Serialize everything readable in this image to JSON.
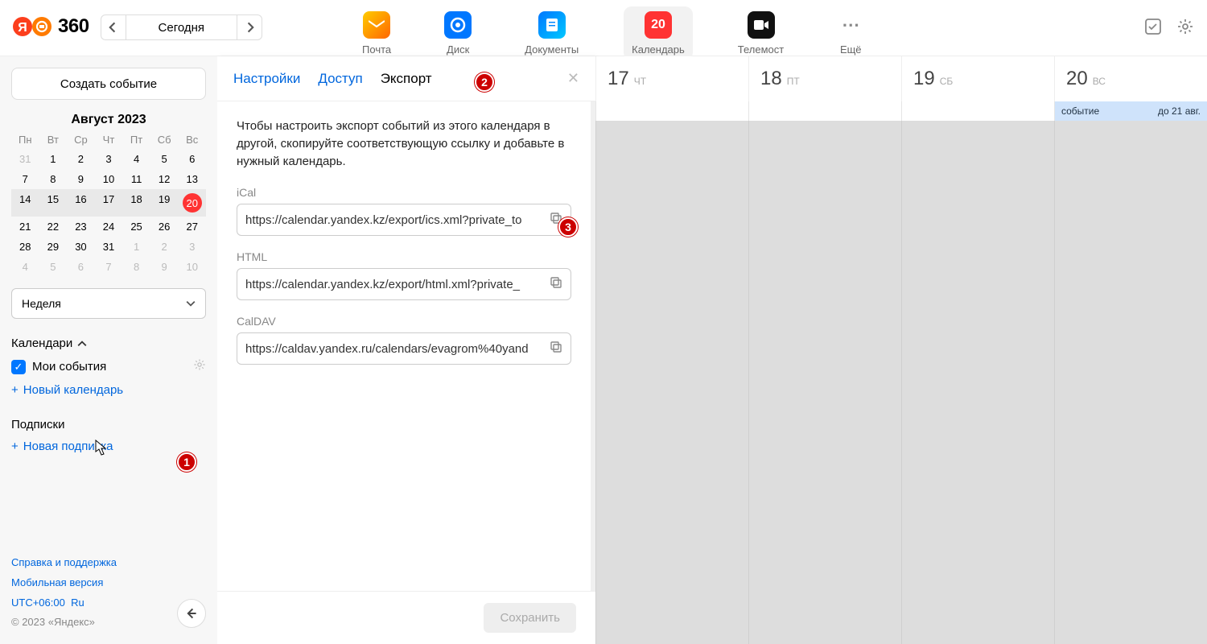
{
  "topbar": {
    "today": "Сегодня",
    "services": {
      "mail": "Почта",
      "disk": "Диск",
      "docs": "Документы",
      "calendar": "Календарь",
      "telemost": "Телемост",
      "more": "Ещё",
      "calendar_badge": "20"
    }
  },
  "sidebar": {
    "create": "Создать событие",
    "month": "Август 2023",
    "dow": [
      "Пн",
      "Вт",
      "Ср",
      "Чт",
      "Пт",
      "Сб",
      "Вс"
    ],
    "weeks": [
      [
        "31",
        "1",
        "2",
        "3",
        "4",
        "5",
        "6"
      ],
      [
        "7",
        "8",
        "9",
        "10",
        "11",
        "12",
        "13"
      ],
      [
        "14",
        "15",
        "16",
        "17",
        "18",
        "19",
        "20"
      ],
      [
        "21",
        "22",
        "23",
        "24",
        "25",
        "26",
        "27"
      ],
      [
        "28",
        "29",
        "30",
        "31",
        "1",
        "2",
        "3"
      ],
      [
        "4",
        "5",
        "6",
        "7",
        "8",
        "9",
        "10"
      ]
    ],
    "view": "Неделя",
    "calendars_label": "Календари",
    "my_events": "Мои события",
    "new_calendar": "Новый календарь",
    "subscriptions_label": "Подписки",
    "new_subscription": "Новая подписка",
    "footer": {
      "help": "Справка и поддержка",
      "mobile": "Мобильная версия",
      "tz": "UTC+06:00",
      "lang": "Ru",
      "copy": "© 2023 «Яндекс»"
    }
  },
  "panel": {
    "tabs": {
      "settings": "Настройки",
      "access": "Доступ",
      "export": "Экспорт"
    },
    "intro": "Чтобы настроить экспорт событий из этого календаря в другой, скопируйте соответствующую ссылку и добавьте в нужный календарь.",
    "fields": {
      "ical_label": "iCal",
      "ical_url": "https://calendar.yandex.kz/export/ics.xml?private_to",
      "html_label": "HTML",
      "html_url": "https://calendar.yandex.kz/export/html.xml?private_",
      "caldav_label": "CalDAV",
      "caldav_url": "https://caldav.yandex.ru/calendars/evagrom%40yand"
    },
    "save": "Сохранить"
  },
  "week": {
    "days": [
      {
        "num": "17",
        "dow": "ЧТ"
      },
      {
        "num": "18",
        "dow": "ПТ"
      },
      {
        "num": "19",
        "dow": "СБ"
      },
      {
        "num": "20",
        "dow": "ВС"
      }
    ],
    "event": {
      "title": "событие",
      "until": "до 21 авг."
    }
  },
  "markers": {
    "one": "1",
    "two": "2",
    "three": "3"
  },
  "logo_text": "360"
}
